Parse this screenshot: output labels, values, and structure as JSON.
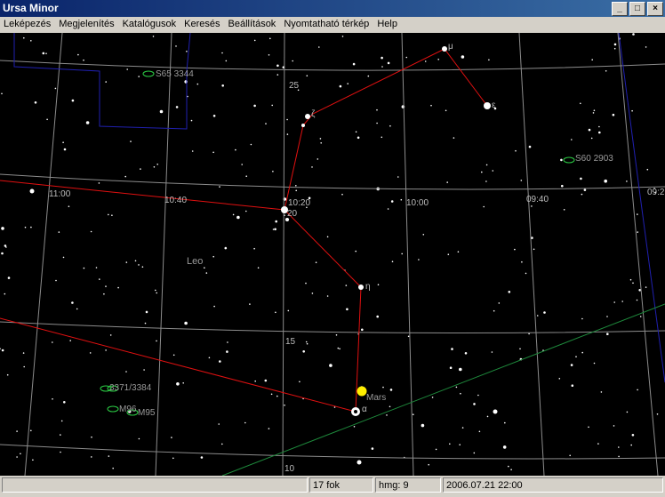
{
  "window": {
    "title": "Ursa Minor"
  },
  "menu": [
    "Leképezés",
    "Megjelenítés",
    "Katalógusok",
    "Keresés",
    "Beállítások",
    "Nyomtatható térkép",
    "Help"
  ],
  "grid_labels": {
    "ra": [
      "11:00",
      "10:40",
      "10:20",
      "10:00",
      "09:40",
      "09:2"
    ],
    "dec": [
      "25",
      "20",
      "15",
      "10"
    ]
  },
  "stars": {
    "mu": "μ",
    "epsilon": "ε",
    "zeta": "ζ",
    "eta": "η",
    "alpha": "α"
  },
  "objects": {
    "s65": "S65 3344",
    "s60": "S60 2903",
    "n3384": "3371/3384",
    "m96": "M96",
    "m95": "M95"
  },
  "constellation": "Leo",
  "planet": {
    "name": "Mars",
    "color": "#ffee00"
  },
  "status": {
    "fov": "17 fok",
    "magnitude": "hmg: 9",
    "datetime": "2006.07.21  22:00"
  },
  "colors": {
    "grid": "#8c8c8c",
    "figure": "#e01010",
    "boundary": "#2020b0",
    "ecliptic": "#1e8a3c"
  }
}
